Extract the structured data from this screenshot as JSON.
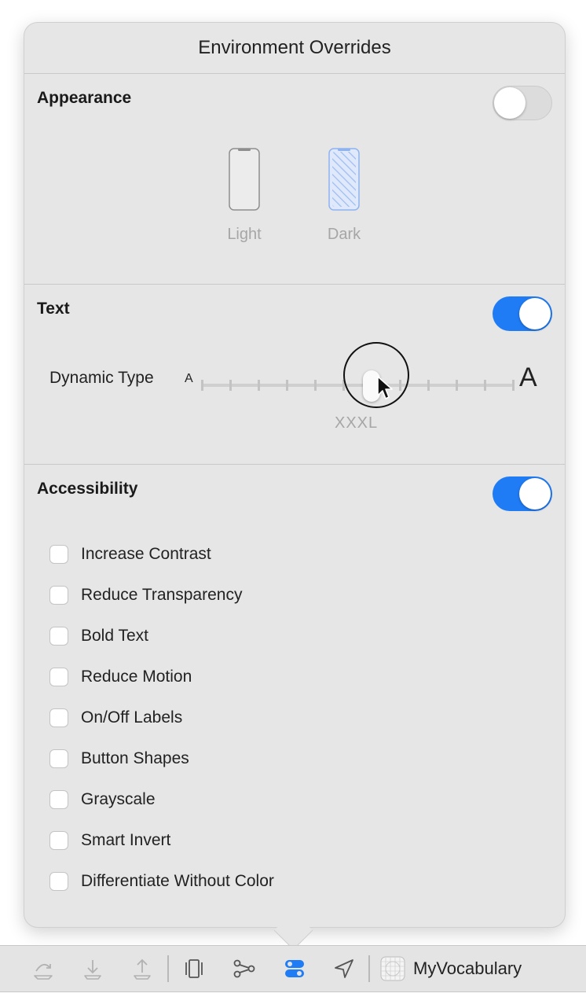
{
  "popover": {
    "title": "Environment Overrides"
  },
  "appearance": {
    "title": "Appearance",
    "toggle_on": false,
    "options": [
      {
        "label": "Light",
        "selected": false
      },
      {
        "label": "Dark",
        "selected": true
      }
    ]
  },
  "text": {
    "title": "Text",
    "toggle_on": true,
    "dynamic_type_label": "Dynamic Type",
    "small_glyph": "A",
    "large_glyph": "A",
    "slider_value": "XXXL",
    "slider_steps": 12,
    "slider_index": 6
  },
  "accessibility": {
    "title": "Accessibility",
    "toggle_on": true,
    "options": [
      {
        "label": "Increase Contrast",
        "checked": false
      },
      {
        "label": "Reduce Transparency",
        "checked": false
      },
      {
        "label": "Bold Text",
        "checked": false
      },
      {
        "label": "Reduce Motion",
        "checked": false
      },
      {
        "label": "On/Off Labels",
        "checked": false
      },
      {
        "label": "Button Shapes",
        "checked": false
      },
      {
        "label": "Grayscale",
        "checked": false
      },
      {
        "label": "Smart Invert",
        "checked": false
      },
      {
        "label": "Differentiate Without Color",
        "checked": false
      }
    ]
  },
  "debug_bar": {
    "scheme_name": "MyVocabulary",
    "icons": [
      "step-over-icon",
      "step-into-icon",
      "step-out-icon",
      "view-hierarchy-icon",
      "memory-graph-icon",
      "environment-overrides-icon",
      "location-icon"
    ]
  },
  "colors": {
    "accent": "#1f7cf5",
    "panel": "#e6e6e6"
  }
}
